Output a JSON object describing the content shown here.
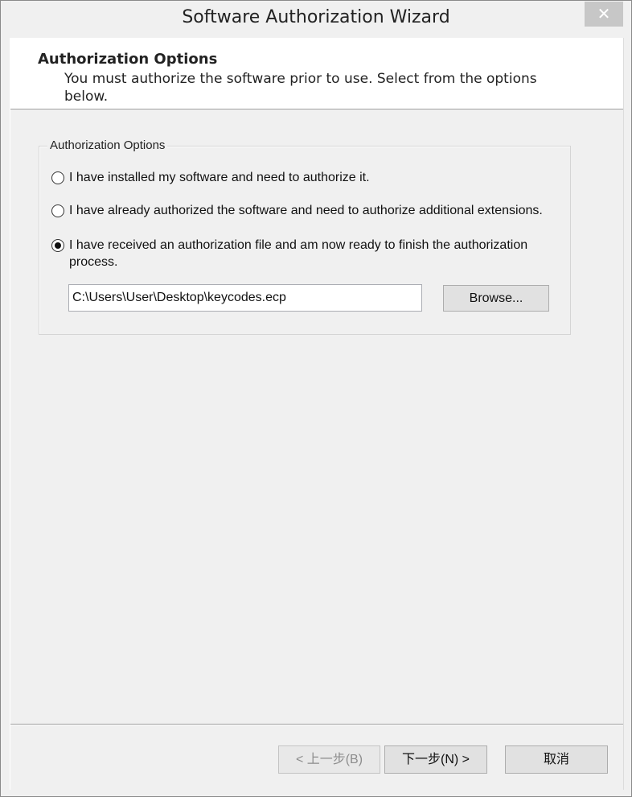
{
  "window": {
    "title": "Software Authorization Wizard",
    "close_glyph": "✕"
  },
  "header": {
    "title": "Authorization Options",
    "description": "You must authorize the software prior to use. Select from the options below."
  },
  "group": {
    "legend": "Authorization Options",
    "options": [
      {
        "label": "I have installed my software and need to authorize it.",
        "selected": false
      },
      {
        "label": "I have already authorized the software and need to authorize additional extensions.",
        "selected": false
      },
      {
        "label": "I have received an authorization file and am now ready to finish the authorization process.",
        "selected": true
      }
    ],
    "file_path": "C:\\Users\\User\\Desktop\\keycodes.ecp",
    "browse_label": "Browse..."
  },
  "footer": {
    "back_label": "< 上一步(B)",
    "next_label": "下一步(N) >",
    "cancel_label": "取消"
  }
}
